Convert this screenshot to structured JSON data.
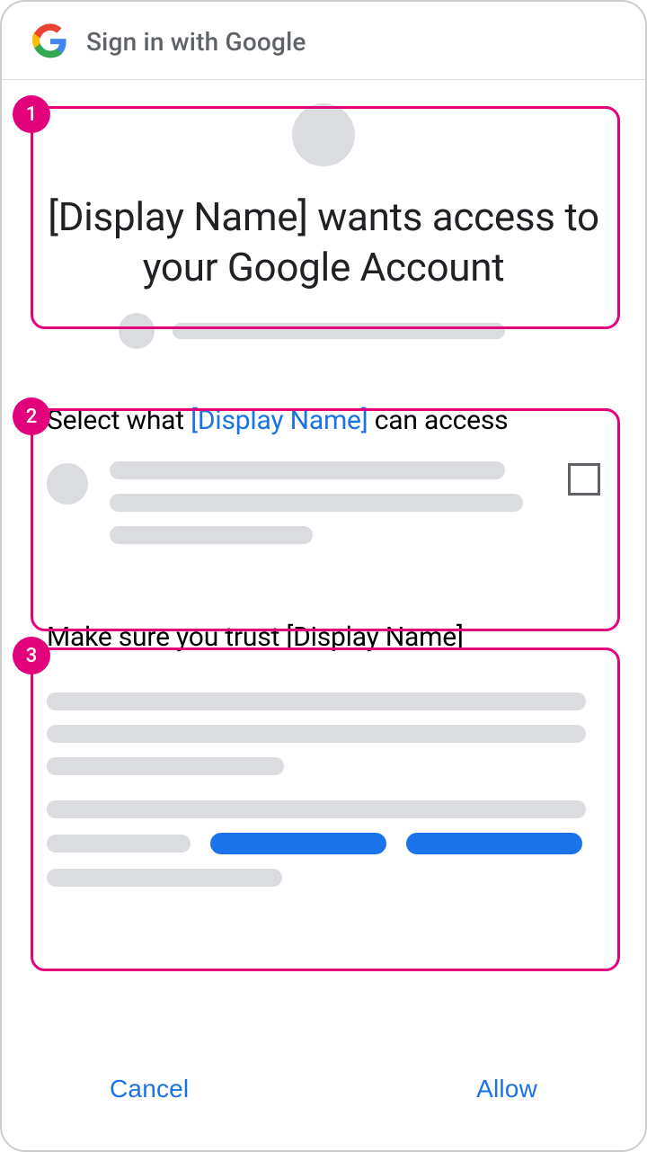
{
  "header": {
    "title": "Sign in with Google"
  },
  "annotations": {
    "b1": "1",
    "b2": "2",
    "b3": "3"
  },
  "consent": {
    "headline": "[Display Name] wants access to your Google Account"
  },
  "scopes": {
    "heading_prefix": "Select what ",
    "heading_app": "[Display Name]",
    "heading_suffix": " can access"
  },
  "trust": {
    "heading": "Make sure you trust [Display Name]"
  },
  "footer": {
    "cancel": "Cancel",
    "allow": "Allow"
  }
}
